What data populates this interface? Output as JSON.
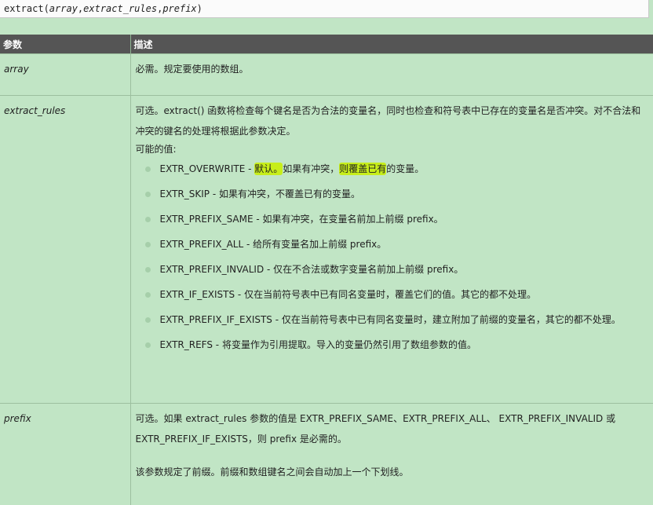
{
  "code": {
    "fn": "extract(",
    "arg1": "array",
    "sep1": ",",
    "arg2": "extract_rules",
    "sep2": ",",
    "arg3": "prefix",
    "close": ")"
  },
  "table": {
    "headers": [
      "参数",
      "描述"
    ],
    "rows": {
      "array": {
        "name": "array",
        "desc": "必需。规定要使用的数组。"
      },
      "extract_rules": {
        "name": "extract_rules",
        "desc1": "可选。extract() 函数将检查每个键名是否为合法的变量名，同时也检查和符号表中已存在的变量名是否冲突。对不合法和冲突的键名的处理将根据此参数决定。",
        "desc2": "可能的值:",
        "options": {
          "overwrite_pre": "EXTR_OVERWRITE - ",
          "overwrite_hl1": "默认。",
          "overwrite_mid": "如果有冲突，",
          "overwrite_hl2": "则覆盖已有",
          "overwrite_post": "的变量。",
          "skip": "EXTR_SKIP - 如果有冲突，不覆盖已有的变量。",
          "prefix_same": "EXTR_PREFIX_SAME - 如果有冲突，在变量名前加上前缀 prefix。",
          "prefix_all": "EXTR_PREFIX_ALL - 给所有变量名加上前缀 prefix。",
          "prefix_invalid": "EXTR_PREFIX_INVALID - 仅在不合法或数字变量名前加上前缀 prefix。",
          "if_exists": "EXTR_IF_EXISTS - 仅在当前符号表中已有同名变量时，覆盖它们的值。其它的都不处理。",
          "prefix_if_exists": "EXTR_PREFIX_IF_EXISTS - 仅在当前符号表中已有同名变量时，建立附加了前缀的变量名，其它的都不处理。",
          "refs": "EXTR_REFS - 将变量作为引用提取。导入的变量仍然引用了数组参数的值。"
        }
      },
      "prefix": {
        "name": "prefix",
        "desc1": "可选。如果 extract_rules 参数的值是 EXTR_PREFIX_SAME、EXTR_PREFIX_ALL、 EXTR_PREFIX_INVALID 或 EXTR_PREFIX_IF_EXISTS，则 prefix 是必需的。",
        "desc2": "该参数规定了前缀。前缀和数组键名之间会自动加上一个下划线。"
      }
    }
  },
  "colors": {
    "background": "#c1e5c5",
    "header": "#555555",
    "highlight": "#c7ee1a"
  }
}
